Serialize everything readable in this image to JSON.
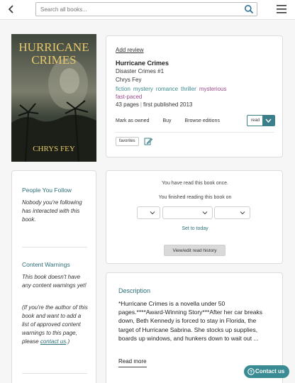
{
  "header": {
    "search_placeholder": "Search all books...",
    "back_icon": "chevron-left-icon",
    "search_icon": "search-icon",
    "menu_icon": "hamburger-menu-icon"
  },
  "cover": {
    "title_text": "HURRICANE CRIMES",
    "author_text": "CHRYS FEY"
  },
  "book": {
    "add_review": "Add review",
    "title": "Hurricane Crimes",
    "series": "Disaster Crimes #1",
    "author": "Chrys Fey",
    "genres": [
      {
        "label": "fiction",
        "color": "#3d8a8e"
      },
      {
        "label": "mystery",
        "color": "#3d8a8e"
      },
      {
        "label": "romance",
        "color": "#3d8a8e"
      },
      {
        "label": "thriller",
        "color": "#3d8a8e"
      },
      {
        "label": "mysterious",
        "color": "#9b4b8b"
      },
      {
        "label": "fast-paced",
        "color": "#9b4b8b"
      }
    ],
    "pages": "43 pages",
    "published": "first published 2013",
    "mark_owned": "Mark as owned",
    "buy": "Buy",
    "browse_editions": "Browse editions",
    "status_button": "read",
    "favorites_tag": "favorites"
  },
  "sidebar": {
    "people_title": "People You Follow",
    "people_text": "Nobody you're following has interacted with this book.",
    "warnings_title": "Content Warnings",
    "warnings_text": "This book doesn't have any content warnings yet!",
    "warnings_author_text": "(If you're the author of this book and want to add a list of approved content warnings to this page, please",
    "contact_link": "contact us",
    "contact_suffix": ".)"
  },
  "read_status": {
    "line1": "You have read this book once.",
    "line2": "You finished reading this book on",
    "set_today": "Set to today",
    "history_button": "View/edit read history"
  },
  "description": {
    "heading": "Description",
    "text": "*Hurricane Crimes is a novella under 50 pages.****Award-Winning Story***After her car breaks down, Beth Kennedy is forced to stay in Florida, the target of Hurricane Sabrina. She stocks up supplies, boards up windows, and hunkers down to wait out ...",
    "read_more": "Read more"
  },
  "contact_button": "Contact us",
  "colors": {
    "accent": "#3a7f8a",
    "link_teal": "#2c6f78",
    "mood_purple": "#9b4b8b",
    "background": "#f6f6f6"
  }
}
